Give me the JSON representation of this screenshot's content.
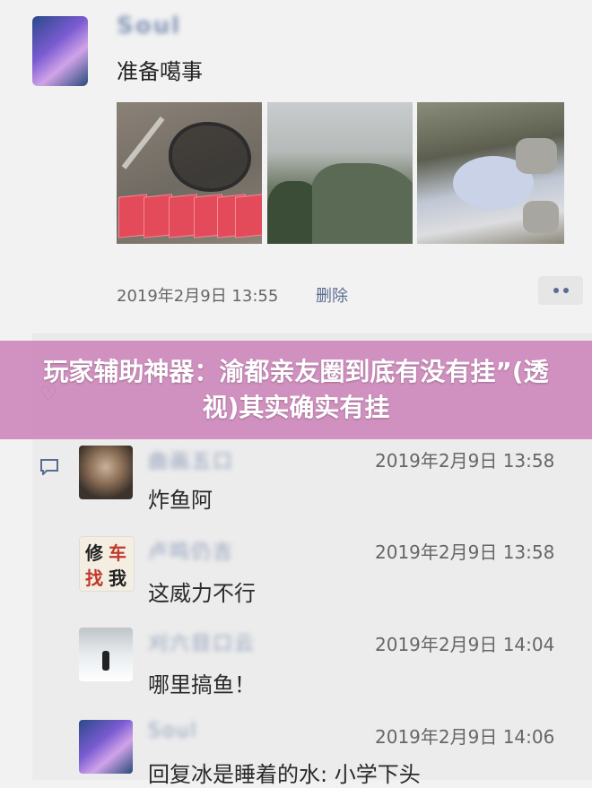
{
  "post": {
    "author": "Soul",
    "text": "准备噶事",
    "time": "2019年2月9日 13:55",
    "delete_label": "删除"
  },
  "headline": "玩家辅助神器：渝都亲友圈到底有没有挂”(透视)其实确实有挂",
  "comments": [
    {
      "name": "曲画五口",
      "time": "2019年2月9日 13:58",
      "text": "炸鱼阿"
    },
    {
      "name": "卢鸣仍吉",
      "time": "2019年2月9日 13:58",
      "text": "这威力不行"
    },
    {
      "name": "刈六目口云",
      "time": "2019年2月9日 14:04",
      "text": "哪里搞鱼！"
    },
    {
      "name": "Soul",
      "time": "2019年2月9日 14:06",
      "text": "回复冰是睡着的水: 小学下头"
    }
  ],
  "stamp_chars": [
    "修",
    "车",
    "找",
    "我"
  ],
  "colors": {
    "banner": "#cd82b9",
    "link": "#5b6c93",
    "envelope": "#e34a5a"
  },
  "icons": [
    "heart-icon",
    "comment-icon",
    "more-icon"
  ]
}
